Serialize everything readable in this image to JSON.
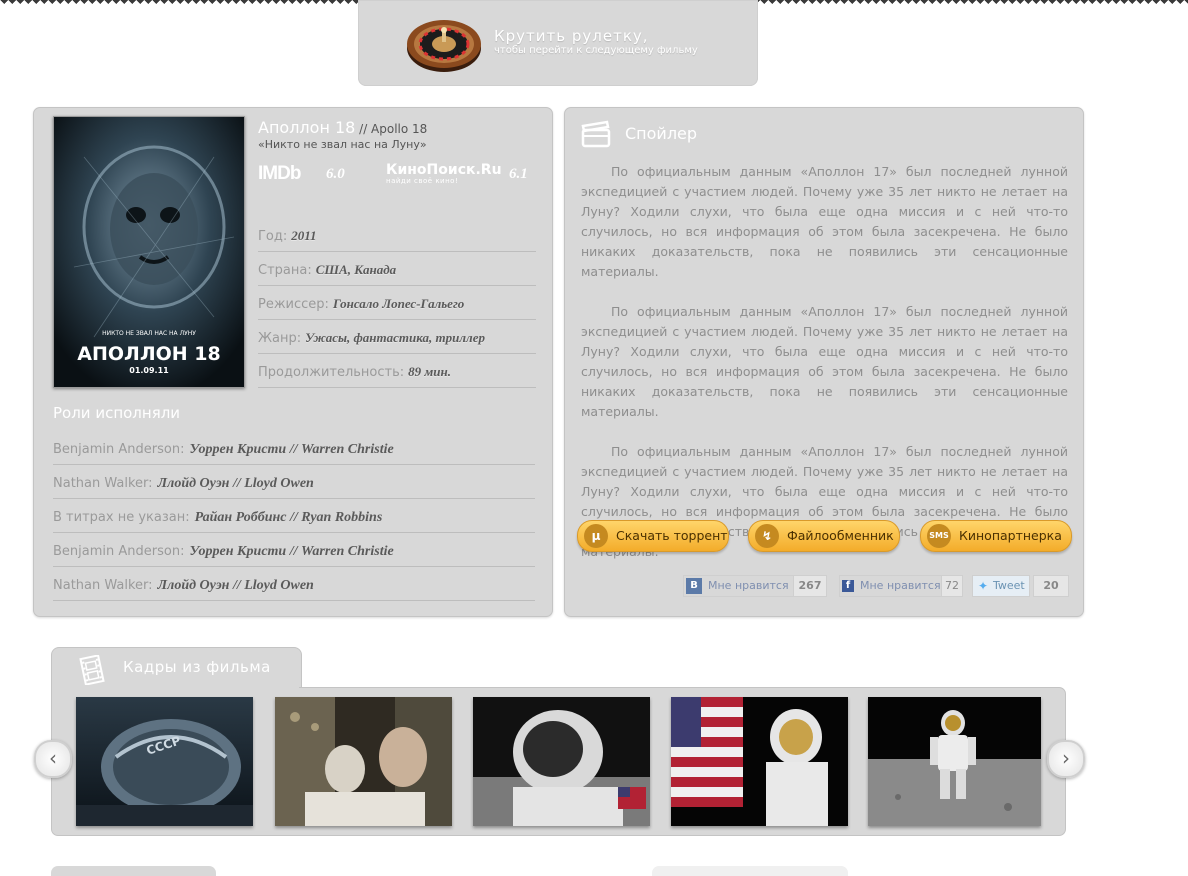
{
  "roulette": {
    "title": "Крутить рулетку,",
    "subtitle": "чтобы перейти к следующему фильму"
  },
  "movie": {
    "title": "Аполлон 18",
    "original_title": " // Apollo 18",
    "tagline": "«Никто не звал нас на Луну»",
    "imdb_label": "IMDb",
    "imdb_rating": "6.0",
    "kinopoisk_label": "КиноПоиск.Ru",
    "kinopoisk_sub": "найди своё кино!",
    "kinopoisk_rating": "6.1",
    "poster": {
      "tagline": "НИКТО НЕ ЗВАЛ НАС НА ЛУНУ",
      "title": "АПОЛЛОН 18",
      "date": "01.09.11"
    },
    "facts": [
      {
        "label": "Год:",
        "value": "2011"
      },
      {
        "label": "Страна:",
        "value": "США, Канада"
      },
      {
        "label": "Режиссер:",
        "value": "Гонсало Лопес-Гальего"
      },
      {
        "label": "Жанр:",
        "value": "Ужасы, фантастика, триллер"
      },
      {
        "label": "Продолжительность:",
        "value": "89 мин."
      }
    ]
  },
  "cast": {
    "title": "Роли исполняли",
    "rows": [
      {
        "role": "Benjamin Anderson:",
        "actor": "Уоррен Кристи // Warren Christie"
      },
      {
        "role": "Nathan Walker:",
        "actor": "Ллойд Оуэн // Lloyd Owen"
      },
      {
        "role": "В титрах не указан:",
        "actor": "Райан Роббинс // Ryan Robbins"
      },
      {
        "role": "Benjamin Anderson:",
        "actor": "Уоррен Кристи // Warren Christie"
      },
      {
        "role": "Nathan Walker:",
        "actor": "Ллойд Оуэн // Lloyd Owen"
      }
    ]
  },
  "spoiler": {
    "title": "Спойлер",
    "paragraphs": [
      "По официальным данным «Аполлон 17» был последней лунной экспедицией с участием людей. Почему уже 35 лет никто не летает на Луну? Ходили слухи, что была еще одна миссия и с ней что-то случилось, но вся информация об этом была засекречена. Не было никаких доказательств, пока не появились эти сенсационные материалы.",
      "По официальным данным «Аполлон 17» был последней лунной экспедицией с участием людей. Почему уже 35 лет никто не летает на Луну? Ходили слухи, что была еще одна миссия и с ней что-то случилось, но вся информация об этом была засекречена. Не было никаких доказательств, пока не появились эти сенсационные материалы.",
      "По официальным данным «Аполлон 17» был последней лунной экспедицией с участием людей. Почему уже 35 лет никто не летает на Луну? Ходили слухи, что была еще одна миссия и с ней что-то случилось, но вся информация об этом была засекречена. Не было никаких доказательств, пока не появились эти сенсационные материалы."
    ],
    "buttons": {
      "torrent": "Скачать торрент",
      "files": "Файлообменник",
      "kino": "Кинопартнерка",
      "sms_icon": "SMS"
    },
    "social": {
      "vk_icon": "В",
      "vk_label": "Мне нравится",
      "vk_count": "267",
      "fb_icon": "f",
      "fb_label": "Мне нравится",
      "fb_count": "72",
      "tw_label": "Tweet",
      "tw_count": "20"
    }
  },
  "frames": {
    "title": "Кадры из фильма",
    "prev": "‹",
    "next": "›",
    "items": [
      "frame-helmet",
      "frame-cockpit",
      "frame-astronaut-closeup",
      "frame-flag",
      "frame-moonwalk"
    ]
  },
  "colors": {
    "panel_bg": "#d8d8d8",
    "button_orange": "#f3ac2a",
    "text_muted": "#8a8a8a",
    "text_dark": "#5a5a5a"
  }
}
